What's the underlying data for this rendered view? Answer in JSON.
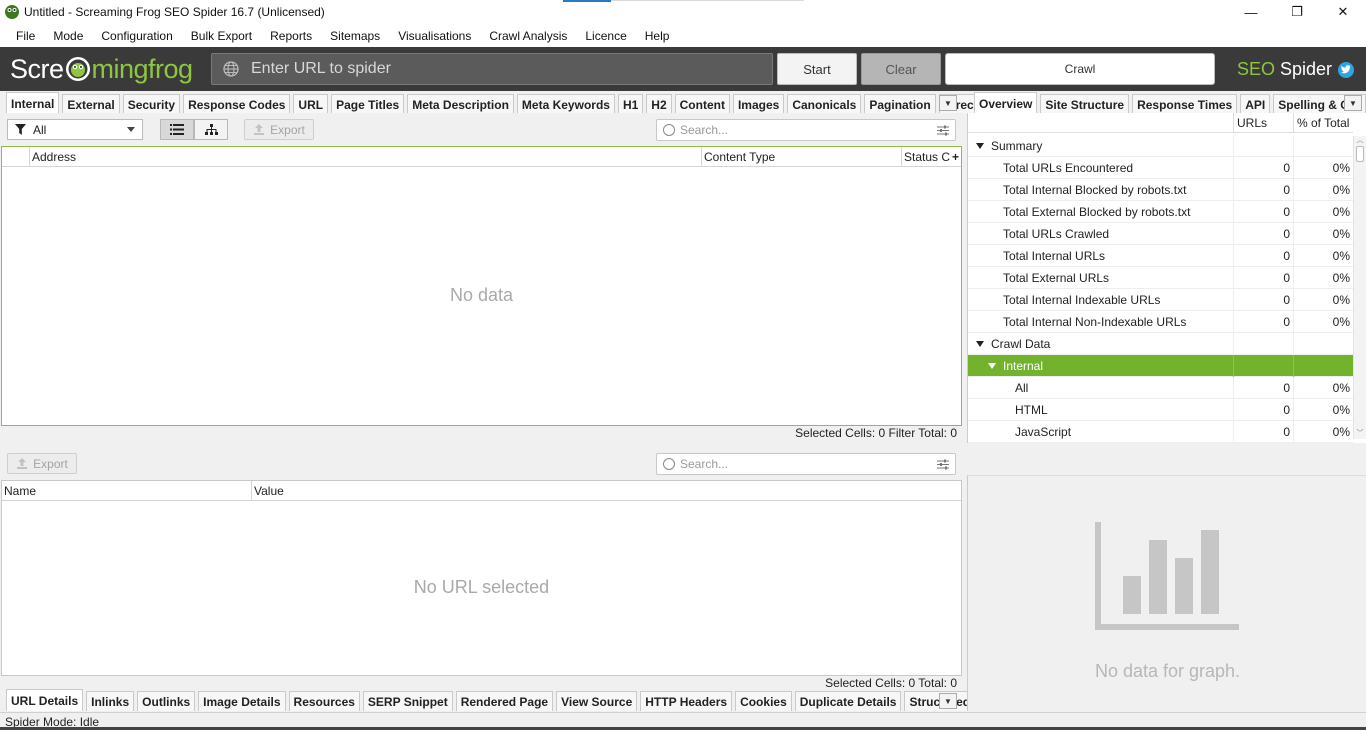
{
  "window": {
    "title": "Untitled - Screaming Frog SEO Spider 16.7 (Unlicensed)",
    "minimize": "—",
    "maximize": "❐",
    "close": "✕"
  },
  "menu": [
    "File",
    "Mode",
    "Configuration",
    "Bulk Export",
    "Reports",
    "Sitemaps",
    "Visualisations",
    "Crawl Analysis",
    "Licence",
    "Help"
  ],
  "header": {
    "logo_part1": "Scre",
    "logo_part2": "mingfrog",
    "url_placeholder": "Enter URL to spider",
    "start_label": "Start",
    "clear_label": "Clear",
    "mode_label": "Crawl",
    "brand_seo": "SEO",
    "brand_spider": "Spider",
    "accent_color": "#8ec63f"
  },
  "main_tabs": [
    "Internal",
    "External",
    "Security",
    "Response Codes",
    "URL",
    "Page Titles",
    "Meta Description",
    "Meta Keywords",
    "H1",
    "H2",
    "Content",
    "Images",
    "Canonicals",
    "Pagination",
    "Directi"
  ],
  "toolbar": {
    "filter_value": "All",
    "export_label": "Export",
    "search_placeholder": "Search..."
  },
  "top_grid": {
    "columns": [
      "Address",
      "Content Type",
      "Status C"
    ],
    "empty_text": "No data",
    "status": "Selected Cells:  0  Filter Total:  0"
  },
  "bottom_panel": {
    "export_label": "Export",
    "search_placeholder": "Search...",
    "columns": [
      "Name",
      "Value"
    ],
    "empty_text": "No URL selected",
    "status": "Selected Cells:  0  Total:  0"
  },
  "bottom_tabs": [
    "URL Details",
    "Inlinks",
    "Outlinks",
    "Image Details",
    "Resources",
    "SERP Snippet",
    "Rendered Page",
    "View Source",
    "HTTP Headers",
    "Cookies",
    "Duplicate Details",
    "Structured Da"
  ],
  "right_tabs": [
    "Overview",
    "Site Structure",
    "Response Times",
    "API",
    "Spelling & Gra"
  ],
  "overview": {
    "col_urls": "URLs",
    "col_pct": "% of Total",
    "rows": [
      {
        "label": "Summary",
        "type": "section",
        "urls": "",
        "pct": ""
      },
      {
        "label": "Total URLs Encountered",
        "type": "item",
        "urls": "0",
        "pct": "0%"
      },
      {
        "label": "Total Internal Blocked by robots.txt",
        "type": "item",
        "urls": "0",
        "pct": "0%"
      },
      {
        "label": "Total External Blocked by robots.txt",
        "type": "item",
        "urls": "0",
        "pct": "0%"
      },
      {
        "label": "Total URLs Crawled",
        "type": "item",
        "urls": "0",
        "pct": "0%"
      },
      {
        "label": "Total Internal URLs",
        "type": "item",
        "urls": "0",
        "pct": "0%"
      },
      {
        "label": "Total External URLs",
        "type": "item",
        "urls": "0",
        "pct": "0%"
      },
      {
        "label": "Total Internal Indexable URLs",
        "type": "item",
        "urls": "0",
        "pct": "0%"
      },
      {
        "label": "Total Internal Non-Indexable URLs",
        "type": "item",
        "urls": "0",
        "pct": "0%"
      },
      {
        "label": "Crawl Data",
        "type": "section",
        "urls": "",
        "pct": ""
      },
      {
        "label": "Internal",
        "type": "subsection",
        "urls": "",
        "pct": ""
      },
      {
        "label": "All",
        "type": "subitem",
        "urls": "0",
        "pct": "0%"
      },
      {
        "label": "HTML",
        "type": "subitem",
        "urls": "0",
        "pct": "0%"
      },
      {
        "label": "JavaScript",
        "type": "subitem",
        "urls": "0",
        "pct": "0%"
      }
    ]
  },
  "graph": {
    "empty_text": "No data for graph."
  },
  "statusbar": {
    "text": "Spider Mode: Idle"
  }
}
